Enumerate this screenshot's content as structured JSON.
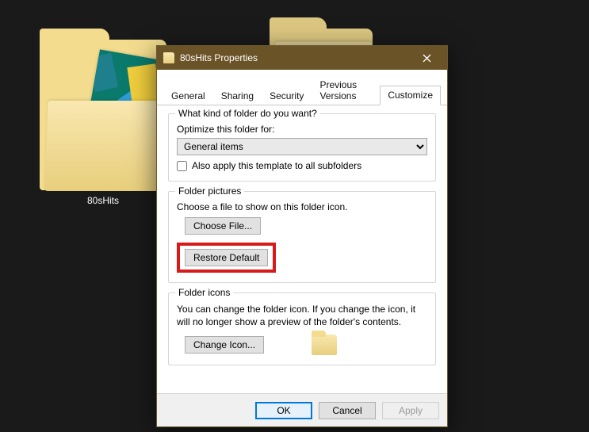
{
  "desktop": {
    "folder_left": {
      "name": "80sHits"
    }
  },
  "dialog": {
    "title": "80sHits Properties",
    "tabs": {
      "general": "General",
      "sharing": "Sharing",
      "security": "Security",
      "previous": "Previous Versions",
      "customize": "Customize"
    },
    "g1": {
      "title": "What kind of folder do you want?",
      "optimize_label": "Optimize this folder for:",
      "combo_value": "General items",
      "apply_sub_label": "Also apply this template to all subfolders"
    },
    "g2": {
      "title": "Folder pictures",
      "prompt": "Choose a file to show on this folder icon.",
      "choose_btn": "Choose File...",
      "restore_btn": "Restore Default"
    },
    "g3": {
      "title": "Folder icons",
      "prompt": "You can change the folder icon. If you change the icon, it will no longer show a preview of the folder's contents.",
      "change_btn": "Change Icon..."
    },
    "buttons": {
      "ok": "OK",
      "cancel": "Cancel",
      "apply": "Apply"
    }
  }
}
